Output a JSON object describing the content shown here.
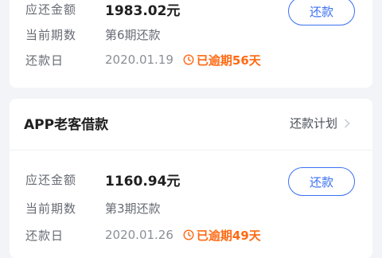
{
  "loans": [
    {
      "amount_label": "应还金额",
      "amount": "1983.02元",
      "period_label": "当前期数",
      "period": "第6期还款",
      "date_label": "还款日",
      "date": "2020.01.19",
      "overdue": "已逾期56天",
      "repay_button": "还款"
    },
    {
      "title": "APP老客借款",
      "plan_link": "还款计划",
      "amount_label": "应还金额",
      "amount": "1160.94元",
      "period_label": "当前期数",
      "period": "第3期还款",
      "date_label": "还款日",
      "date": "2020.01.26",
      "overdue": "已逾期49天",
      "repay_button": "还款"
    }
  ],
  "colors": {
    "accent": "#3a70f2",
    "overdue": "#ff6a13",
    "background": "#f3f4f7"
  },
  "icons": {
    "overdue": "clock-icon",
    "plan_link": "chevron-right-icon"
  }
}
